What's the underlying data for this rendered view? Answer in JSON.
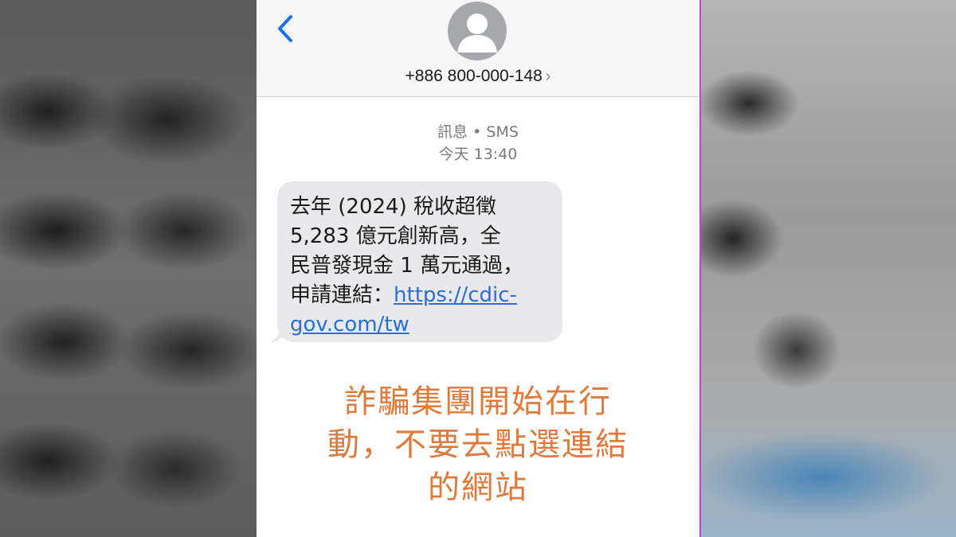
{
  "header": {
    "back_icon": "chevron-left-icon",
    "avatar_icon": "person-icon",
    "contact_number": "+886 800-000-148",
    "contact_chevron": "›"
  },
  "thread": {
    "service_label": "訊息 • SMS",
    "timestamp": "今天 13:40"
  },
  "message": {
    "line1": "去年 (2024) 稅收超徵",
    "line2": "5,283 億元創新高，全",
    "line3": "民普發現金 1 萬元通過，",
    "line4_prefix": "申請連結：",
    "link_part1": "https://cdic-",
    "link_part2": "gov.com/tw"
  },
  "warning": {
    "line1": "詐騙集團開始在行",
    "line2": "動，不要去點選連結",
    "line3": "的網站"
  },
  "colors": {
    "link": "#2a6fd6",
    "warning": "#e07a3c",
    "bubble": "#e9e9eb",
    "accent": "#1a73e8"
  }
}
